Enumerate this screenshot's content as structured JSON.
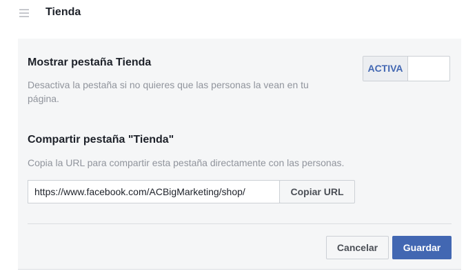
{
  "header": {
    "title": "Tienda",
    "menu_icon": "hamburger-menu-icon"
  },
  "show_tab": {
    "title": "Mostrar pestaña Tienda",
    "description_line1": "Desactiva la pestaña si no quieres que las personas la vean en tu",
    "description_line2": "página.",
    "toggle_label": "ACTIVA",
    "toggle_state": "on"
  },
  "share_tab": {
    "title": "Compartir pestaña \"Tienda\"",
    "description": "Copia la URL para compartir esta pestaña directamente con las personas.",
    "url_value": "https://www.facebook.com/ACBigMarketing/shop/",
    "copy_label": "Copiar URL"
  },
  "actions": {
    "cancel_label": "Cancelar",
    "save_label": "Guardar"
  },
  "colors": {
    "accent": "#4267b2",
    "panel_bg": "#f5f6f7",
    "muted_text": "#90949c",
    "border": "#ccd0d5"
  }
}
